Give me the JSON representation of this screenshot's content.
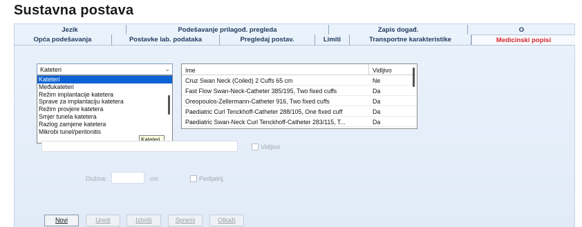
{
  "page": {
    "title": "Sustavna postava"
  },
  "tabs": {
    "top": [
      "Jezik",
      "Podešavanje prilagođ. pregleda",
      "Zapis događ.",
      "O"
    ],
    "bottom": [
      "Opća podešavanja",
      "Postavke lab. podataka",
      "Pregledaj postav.",
      "Limiti",
      "Transportne karakteristike",
      "Medicinski popisi"
    ],
    "active": "Medicinski popisi"
  },
  "category_select": {
    "value": "Kateteri",
    "options": [
      "Kateteri",
      "Međukateteri",
      "Režim implantacije katetera",
      "Sprave za implantaciju katetera",
      "Režim provjere katetera",
      "Smjer tunela katetera",
      "Razlog zamjene katetera",
      "Mikrobi tunel/peritonitis"
    ],
    "selected_index": 0,
    "tooltip": "Kateteri"
  },
  "list_table": {
    "columns": [
      "Ime",
      "Vidljivo"
    ],
    "rows": [
      [
        "Cruz Swan Neck (Coiled) 2 Cuffs 65 cm",
        "Ne"
      ],
      [
        "Fast Flow Swan-Neck-Catheter 385/195, Two fixed cuffs",
        "Da"
      ],
      [
        "Oreopoulos-Zellermann-Catheter 916, Two fixed cuffs",
        "Da"
      ],
      [
        "Paediatric Curl Tenckhoff-Catheter 288/105, One fixed cuff",
        "Da"
      ],
      [
        "Paediatric Swan-Neck Curl Tenckhoff-Catheter 283/115, T...",
        "Da"
      ]
    ]
  },
  "form": {
    "name_value": "",
    "visible_label": "Vidljivo",
    "length_label": "Dužina:",
    "length_value": "",
    "length_unit": "cm",
    "pediatric_label": "Pedijatrij."
  },
  "buttons": {
    "new": "Novi",
    "edit": "Uredi",
    "delete": "Izbriši",
    "save": "Spremi",
    "cancel": "Otkaži"
  },
  "colors": {
    "active_tab": "#d8262b",
    "selection": "#0a62d4",
    "tab_text": "#223b5e"
  }
}
